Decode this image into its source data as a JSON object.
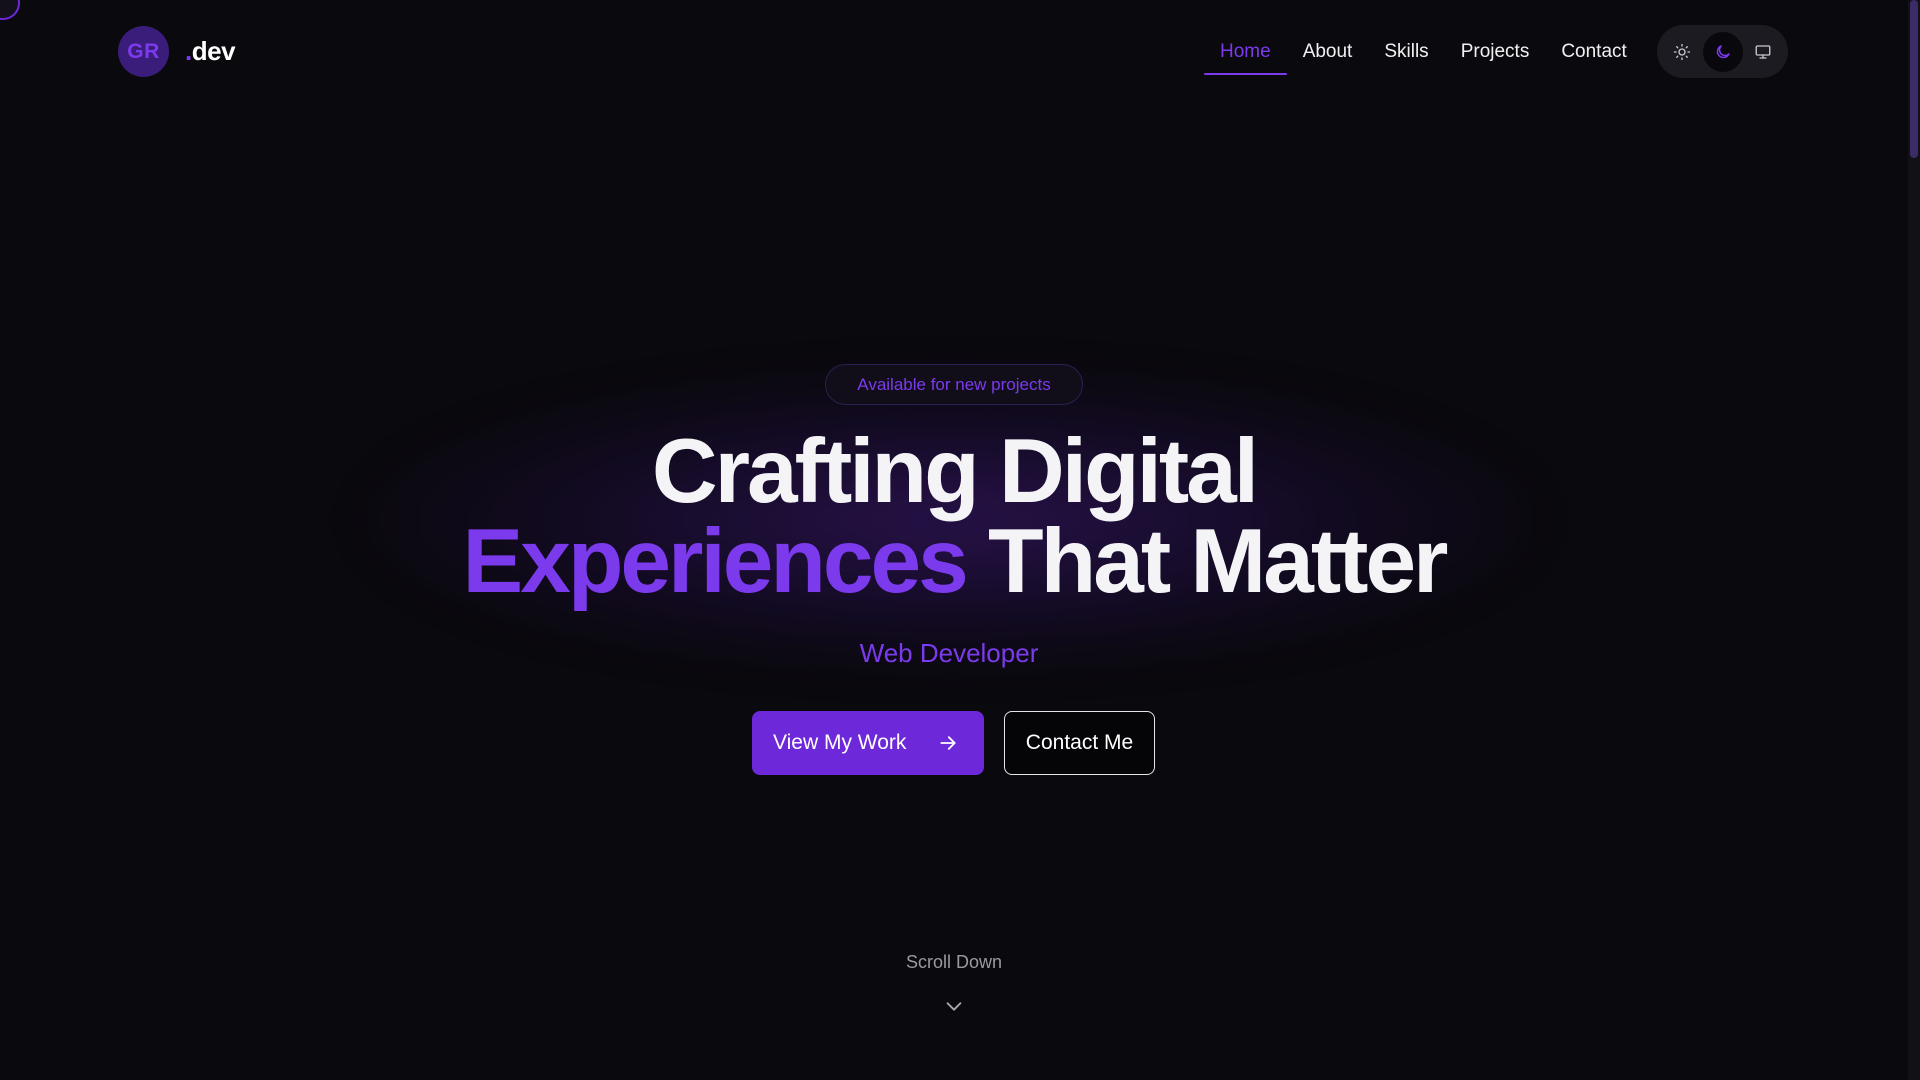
{
  "brand": {
    "initials": "GR",
    "dot": ".",
    "suffix": "dev"
  },
  "nav": {
    "items": [
      {
        "label": "Home",
        "active": true
      },
      {
        "label": "About"
      },
      {
        "label": "Skills"
      },
      {
        "label": "Projects"
      },
      {
        "label": "Contact"
      }
    ]
  },
  "theme_switcher": {
    "options": [
      {
        "icon": "sun-icon",
        "mode": "light"
      },
      {
        "icon": "moon-icon",
        "mode": "dark",
        "active": true
      },
      {
        "icon": "monitor-icon",
        "mode": "system"
      }
    ]
  },
  "hero": {
    "badge": "Available for new projects",
    "headline_line1": "Crafting Digital",
    "headline_accent": "Experiences",
    "headline_rest": " That Matter",
    "role": "Web Developer",
    "primary_cta": "View My Work",
    "secondary_cta": "Contact Me",
    "scroll_hint": "Scroll Down"
  },
  "colors": {
    "background": "#0a090d",
    "accent": "#7c3aed",
    "button_primary": "#6d28d9",
    "text": "#f4f4f6"
  }
}
